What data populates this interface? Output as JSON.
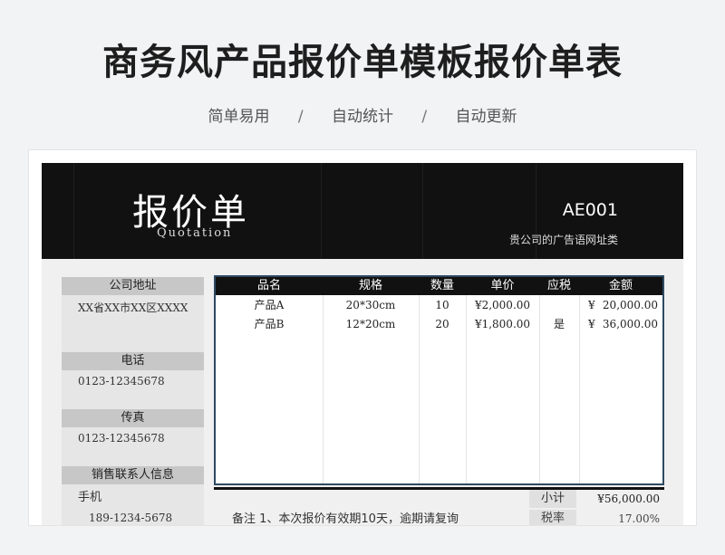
{
  "title": "商务风产品报价单模板报价单表",
  "features": [
    "简单易用",
    "自动统计",
    "自动更新"
  ],
  "feature_separator": "/",
  "header": {
    "title": "报价单",
    "subtitle": "Quotation",
    "number": "AE001",
    "ad": "贵公司的广告语网址类"
  },
  "left": {
    "address_label": "公司地址",
    "address_value": "XX省XX市XX区XXXX",
    "phone_label": "电话",
    "phone_value": "0123-12345678",
    "fax_label": "传真",
    "fax_value": "0123-12345678",
    "contact_label": "销售联系人信息",
    "contact_field": "手机",
    "contact_value": "189-1234-5678"
  },
  "table": {
    "headers": [
      "品名",
      "规格",
      "数量",
      "单价",
      "应税",
      "金额"
    ],
    "rows": [
      {
        "name": "产品A",
        "spec": "20*30cm",
        "qty": "10",
        "price": "¥2,000.00",
        "tax": "",
        "cur": "¥",
        "amount": "20,000.00"
      },
      {
        "name": "产品B",
        "spec": "12*20cm",
        "qty": "20",
        "price": "¥1,800.00",
        "tax": "是",
        "cur": "¥",
        "amount": "36,000.00"
      }
    ]
  },
  "summary": {
    "subtotal_label": "小计",
    "subtotal_value": "¥56,000.00",
    "tax_label": "税率",
    "tax_value": "17.00%",
    "note": "备注    1、本次报价有效期10天，逾期请复询"
  }
}
